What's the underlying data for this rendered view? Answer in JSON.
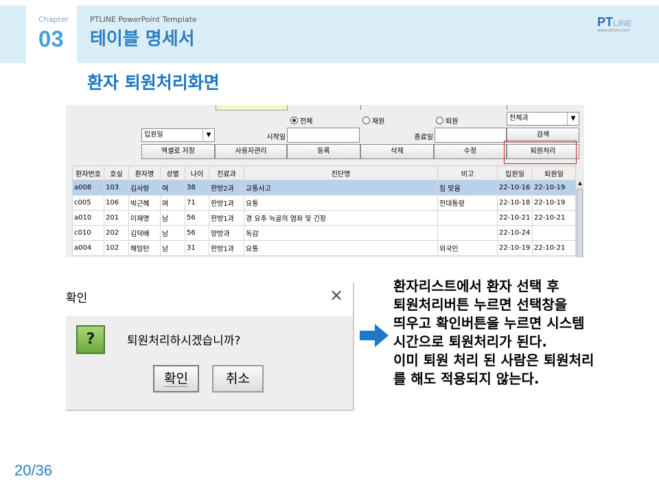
{
  "header": {
    "chapter_label": "Chapter",
    "chapter_number": "03",
    "template_name": "PTLINE PowerPoint Template",
    "page_title": "테이블 명세서",
    "logo_main": "PT",
    "logo_line": "LINE",
    "logo_sub": "www.ptline.com"
  },
  "section_title": "환자 퇴원처리화면",
  "app": {
    "radios": [
      {
        "label": "전체",
        "selected": true
      },
      {
        "label": "재원",
        "selected": false
      },
      {
        "label": "퇴원",
        "selected": false
      }
    ],
    "dept_select": "전체과",
    "date_type_select": "입원일",
    "start_label": "시작일",
    "end_label": "종료일",
    "search_button": "검색",
    "buttons": [
      "엑셀로 저장",
      "사용자관리",
      "등록",
      "삭제",
      "수정",
      "퇴원처리"
    ],
    "columns": [
      "환자번호",
      "호실",
      "환자명",
      "성별",
      "나이",
      "진료과",
      "진단명",
      "비고",
      "입원일",
      "퇴원일"
    ],
    "rows": [
      [
        "a008",
        "103",
        "김사랑",
        "여",
        "38",
        "한방2과",
        "교통사고",
        "침 맞음",
        "22-10-16",
        "22-10-19"
      ],
      [
        "c005",
        "106",
        "박근혜",
        "여",
        "71",
        "한방1과",
        "요통",
        "전대통령",
        "22-10-18",
        "22-10-19"
      ],
      [
        "a010",
        "201",
        "이재명",
        "남",
        "56",
        "한방1과",
        "경 요추 늑골의 염좌 및 긴장",
        "",
        "22-10-21",
        "22-10-21"
      ],
      [
        "c010",
        "202",
        "김덕배",
        "남",
        "56",
        "양방과",
        "독감",
        "",
        "22-10-24",
        ""
      ],
      [
        "a004",
        "102",
        "해밍턴",
        "남",
        "31",
        "한방1과",
        "요통",
        "외국인",
        "22-10-19",
        "22-10-21"
      ]
    ]
  },
  "dialog": {
    "title": "확인",
    "close_glyph": "×",
    "icon_glyph": "?",
    "message": "퇴원처리하시겠습니까?",
    "ok_label": "확인",
    "cancel_label": "취소"
  },
  "description": [
    "환자리스트에서 환자 선택 후",
    "퇴원처리버튼 누르면 선택창을",
    "띄우고 확인버튼을 누르면 시스템",
    "시간으로 퇴원처리가 된다.",
    "이미 퇴원 처리 된 사람은 퇴원처리",
    "를 해도 적용되지 않는다."
  ],
  "page_number": "20/36",
  "colors": {
    "accent": "#2a7fc0",
    "header_band": "#daeef9",
    "selected_row": "#b9d1ea",
    "highlight_box": "#c82828",
    "arrow": "#1e78c8"
  },
  "icons": [
    "question-icon",
    "close-icon",
    "right-arrow-icon",
    "dropdown-arrow-icon"
  ]
}
